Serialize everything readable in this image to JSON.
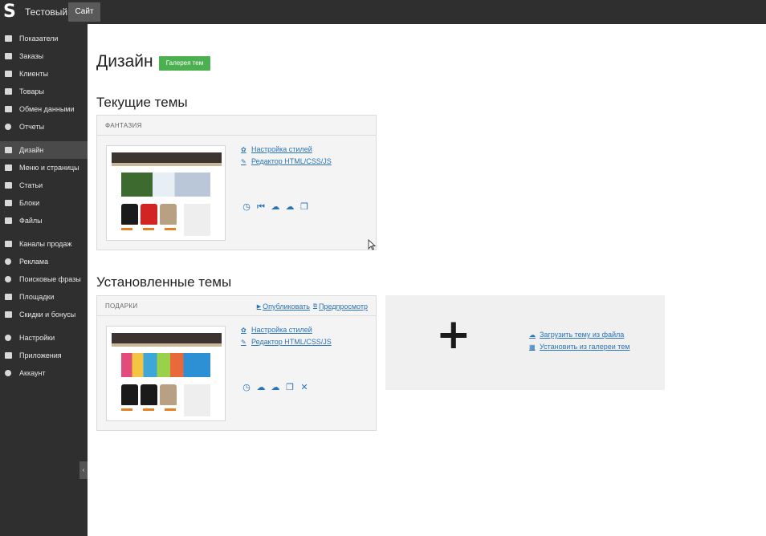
{
  "header": {
    "app_title": "Тестовый",
    "site_button": "Сайт",
    "logo_icon": "logo-s-icon"
  },
  "sidebar": {
    "items": [
      {
        "label": "Показатели",
        "icon": "bar-chart-icon"
      },
      {
        "label": "Заказы",
        "icon": "cart-icon"
      },
      {
        "label": "Клиенты",
        "icon": "users-icon"
      },
      {
        "label": "Товары",
        "icon": "book-icon"
      },
      {
        "label": "Обмен данными",
        "icon": "exchange-icon"
      },
      {
        "label": "Отчеты",
        "icon": "pie-chart-icon"
      },
      {
        "label": "Дизайн",
        "icon": "picture-icon",
        "active": true
      },
      {
        "label": "Меню и страницы",
        "icon": "list-icon"
      },
      {
        "label": "Статьи",
        "icon": "copy-icon"
      },
      {
        "label": "Блоки",
        "icon": "blocks-icon"
      },
      {
        "label": "Файлы",
        "icon": "folder-icon"
      },
      {
        "label": "Каналы продаж",
        "icon": "funnel-icon"
      },
      {
        "label": "Реклама",
        "icon": "target-icon"
      },
      {
        "label": "Поисковые фразы",
        "icon": "search-icon"
      },
      {
        "label": "Площадки",
        "icon": "lines-icon"
      },
      {
        "label": "Скидки и бонусы",
        "icon": "gift-icon"
      },
      {
        "label": "Настройки",
        "icon": "gear-icon"
      },
      {
        "label": "Приложения",
        "icon": "link-icon"
      },
      {
        "label": "Аккаунт",
        "icon": "user-icon"
      }
    ],
    "collapse_glyph": "‹"
  },
  "main": {
    "title": "Дизайн",
    "gallery_button": "Галерея тем",
    "current_section": "Текущие темы",
    "installed_section": "Установленные темы"
  },
  "current_theme": {
    "name": "ФАНТАЗИЯ",
    "link_styles": "Настройка стилей",
    "link_editor": "Редактор HTML/CSS/JS",
    "actions": [
      "history-icon",
      "rewind-icon",
      "cloud-download-icon",
      "cloud-upload-icon",
      "copy-icon"
    ]
  },
  "installed_theme": {
    "name": "ПОДАРКИ",
    "publish": "Опубликовать",
    "preview": "Предпросмотр",
    "link_styles": "Настройка стилей",
    "link_editor": "Редактор HTML/CSS/JS",
    "actions": [
      "history-icon",
      "cloud-download-icon",
      "cloud-upload-icon",
      "copy-icon",
      "delete-icon"
    ]
  },
  "add_theme": {
    "upload": "Загрузить тему из файла",
    "install_gallery": "Установить из галереи тем"
  },
  "colors": {
    "accent_green": "#4caf50",
    "link_blue": "#2a73b8",
    "sidebar_bg": "#2f2f2f"
  }
}
